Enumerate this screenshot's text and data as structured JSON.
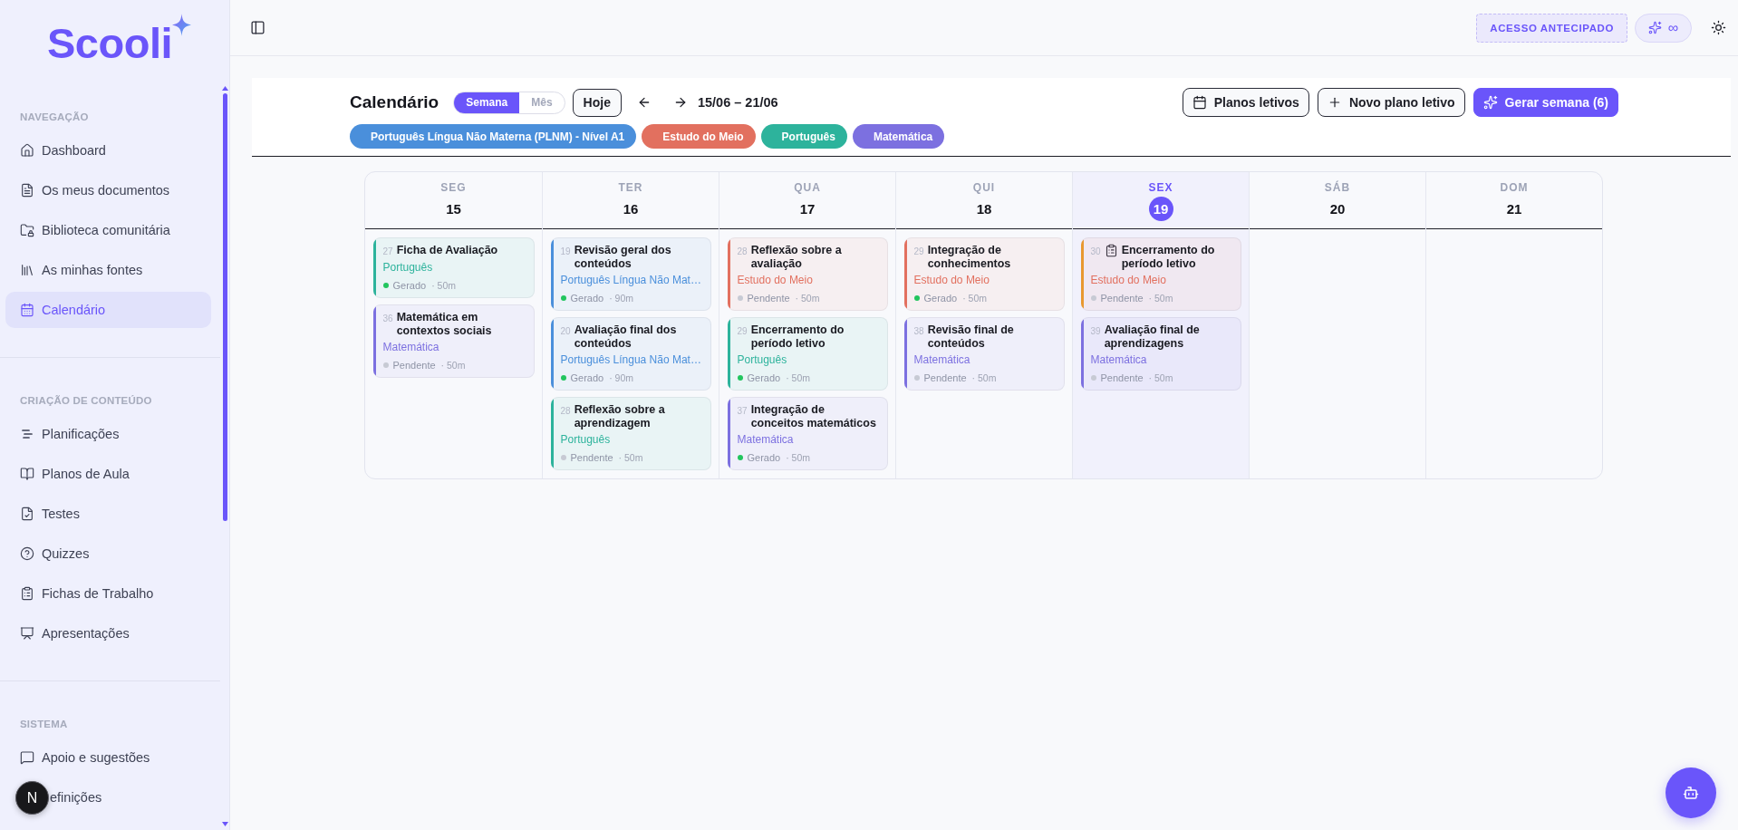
{
  "sidebar": {
    "logo": "Scooli",
    "sections": [
      {
        "title": "NAVEGAÇÃO",
        "items": [
          {
            "label": "Dashboard",
            "selected": false
          },
          {
            "label": "Os meus documentos",
            "selected": false
          },
          {
            "label": "Biblioteca comunitária",
            "selected": false
          },
          {
            "label": "As minhas fontes",
            "selected": false
          },
          {
            "label": "Calendário",
            "selected": true
          }
        ]
      },
      {
        "title": "CRIAÇÃO DE CONTEÚDO",
        "items": [
          {
            "label": "Planificações",
            "selected": false
          },
          {
            "label": "Planos de Aula",
            "selected": false
          },
          {
            "label": "Testes",
            "selected": false
          },
          {
            "label": "Quizzes",
            "selected": false
          },
          {
            "label": "Fichas de Trabalho",
            "selected": false
          },
          {
            "label": "Apresentações",
            "selected": false
          }
        ]
      },
      {
        "title": "SISTEMA",
        "items": [
          {
            "label": "Apoio e sugestões",
            "selected": false
          },
          {
            "label": "efinições",
            "selected": false
          }
        ]
      }
    ]
  },
  "dev_badge": {
    "label": "N"
  },
  "topbar": {
    "early_access": "ACESSO ANTECIPADO",
    "credits": "∞"
  },
  "calendar": {
    "title": "Calendário",
    "views": [
      {
        "label": "Semana",
        "selected": true
      },
      {
        "label": "Mês",
        "selected": false
      }
    ],
    "today_button": "Hoje",
    "range": "15/06 – 21/06",
    "actions": [
      {
        "label": "Planos letivos",
        "kind": "outline"
      },
      {
        "label": "Novo plano letivo",
        "kind": "outline"
      },
      {
        "label": "Gerar semana (6)",
        "kind": "primary"
      }
    ],
    "subjects": [
      {
        "label": "Português Língua Não Materna (PLNM) - Nível A1",
        "color": "#4a8fdb"
      },
      {
        "label": "Estudo do Meio",
        "color": "#e2705f"
      },
      {
        "label": "Português",
        "color": "#2db39c"
      },
      {
        "label": "Matemática",
        "color": "#7c70e0"
      }
    ],
    "days": [
      {
        "label": "SEG",
        "date": "15",
        "today": false,
        "lessons": [
          {
            "number": "27",
            "title": "Ficha de Avaliação",
            "kind": "lesson",
            "color": "#2db39c",
            "subject": {
              "label": "Português",
              "color": "#2db39c"
            },
            "status": "Gerado",
            "generated": true,
            "duration": "· 50m"
          },
          {
            "number": "36",
            "title": "Matemática em contextos sociais",
            "kind": "lesson",
            "color": "#7c70e0",
            "subject": {
              "label": "Matemática",
              "color": "#7c70e0"
            },
            "status": "Pendente",
            "generated": false,
            "duration": "· 50m"
          }
        ]
      },
      {
        "label": "TER",
        "date": "16",
        "today": false,
        "lessons": [
          {
            "number": "19",
            "title": "Revisão geral dos conteúdos",
            "kind": "lesson",
            "color": "#4a8fdb",
            "subject": {
              "label": "Português Língua Não Mat…",
              "color": "#4a8fdb"
            },
            "status": "Gerado",
            "generated": true,
            "duration": "· 90m"
          },
          {
            "number": "20",
            "title": "Avaliação final dos conteúdos",
            "kind": "lesson",
            "color": "#4a8fdb",
            "subject": {
              "label": "Português Língua Não Mat…",
              "color": "#4a8fdb"
            },
            "status": "Gerado",
            "generated": true,
            "duration": "· 90m"
          },
          {
            "number": "28",
            "title": "Reflexão sobre a aprendizagem",
            "kind": "lesson",
            "color": "#2db39c",
            "subject": {
              "label": "Português",
              "color": "#2db39c"
            },
            "status": "Pendente",
            "generated": false,
            "duration": "· 50m"
          }
        ]
      },
      {
        "label": "QUA",
        "date": "17",
        "today": false,
        "lessons": [
          {
            "number": "28",
            "title": "Reflexão sobre a avaliação",
            "kind": "lesson",
            "color": "#e2705f",
            "subject": {
              "label": "Estudo do Meio",
              "color": "#e2705f"
            },
            "status": "Pendente",
            "generated": false,
            "duration": "· 50m"
          },
          {
            "number": "29",
            "title": "Encerramento do período letivo",
            "kind": "lesson",
            "color": "#2db39c",
            "subject": {
              "label": "Português",
              "color": "#2db39c"
            },
            "status": "Gerado",
            "generated": true,
            "duration": "· 50m"
          },
          {
            "number": "37",
            "title": "Integração de conceitos matemáticos",
            "kind": "lesson",
            "color": "#7c70e0",
            "subject": {
              "label": "Matemática",
              "color": "#7c70e0"
            },
            "status": "Gerado",
            "generated": true,
            "duration": "· 50m"
          }
        ]
      },
      {
        "label": "QUI",
        "date": "18",
        "today": false,
        "lessons": [
          {
            "number": "29",
            "title": "Integração de conhecimentos",
            "kind": "lesson",
            "color": "#e2705f",
            "subject": {
              "label": "Estudo do Meio",
              "color": "#e2705f"
            },
            "status": "Gerado",
            "generated": true,
            "duration": "· 50m"
          },
          {
            "number": "38",
            "title": "Revisão final de conteúdos",
            "kind": "lesson",
            "color": "#7c70e0",
            "subject": {
              "label": "Matemática",
              "color": "#7c70e0"
            },
            "status": "Pendente",
            "generated": false,
            "duration": "· 50m"
          }
        ]
      },
      {
        "label": "SEX",
        "date": "19",
        "today": true,
        "lessons": [
          {
            "number": "30",
            "title": "Encerramento do período letivo",
            "kind": "assessment",
            "color": "#e8982f",
            "subject": {
              "label": "Estudo do Meio",
              "color": "#e2705f"
            },
            "status": "Pendente",
            "generated": false,
            "duration": "· 50m"
          },
          {
            "number": "39",
            "title": "Avaliação final de aprendizagens",
            "kind": "lesson",
            "color": "#7c70e0",
            "subject": {
              "label": "Matemática",
              "color": "#7c70e0"
            },
            "status": "Pendente",
            "generated": false,
            "duration": "· 50m"
          }
        ]
      },
      {
        "label": "SÁB",
        "date": "20",
        "today": false
      },
      {
        "label": "DOM",
        "date": "21",
        "today": false
      }
    ]
  }
}
